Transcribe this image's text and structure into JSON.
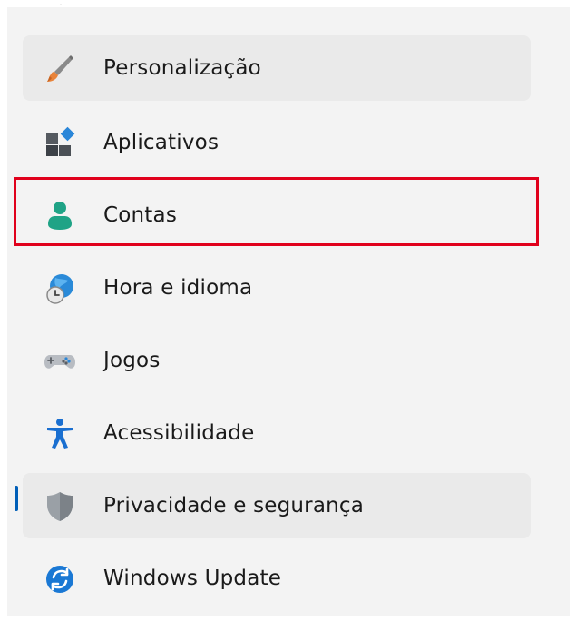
{
  "sidebar": {
    "items": [
      {
        "label": "Personalização",
        "icon": "brush-icon",
        "state": "hover"
      },
      {
        "label": "Aplicativos",
        "icon": "apps-icon",
        "state": "normal"
      },
      {
        "label": "Contas",
        "icon": "person-icon",
        "state": "normal"
      },
      {
        "label": "Hora e idioma",
        "icon": "globe-clock-icon",
        "state": "normal"
      },
      {
        "label": "Jogos",
        "icon": "gamepad-icon",
        "state": "normal"
      },
      {
        "label": "Acessibilidade",
        "icon": "accessibility-icon",
        "state": "normal"
      },
      {
        "label": "Privacidade e segurança",
        "icon": "shield-icon",
        "state": "selected"
      },
      {
        "label": "Windows Update",
        "icon": "refresh-icon",
        "state": "normal"
      }
    ]
  },
  "annotation": {
    "highlighted_item": "Contas",
    "color": "#e0001b"
  },
  "colors": {
    "accent": "#005fb8",
    "person_icon": "#1fa386"
  }
}
